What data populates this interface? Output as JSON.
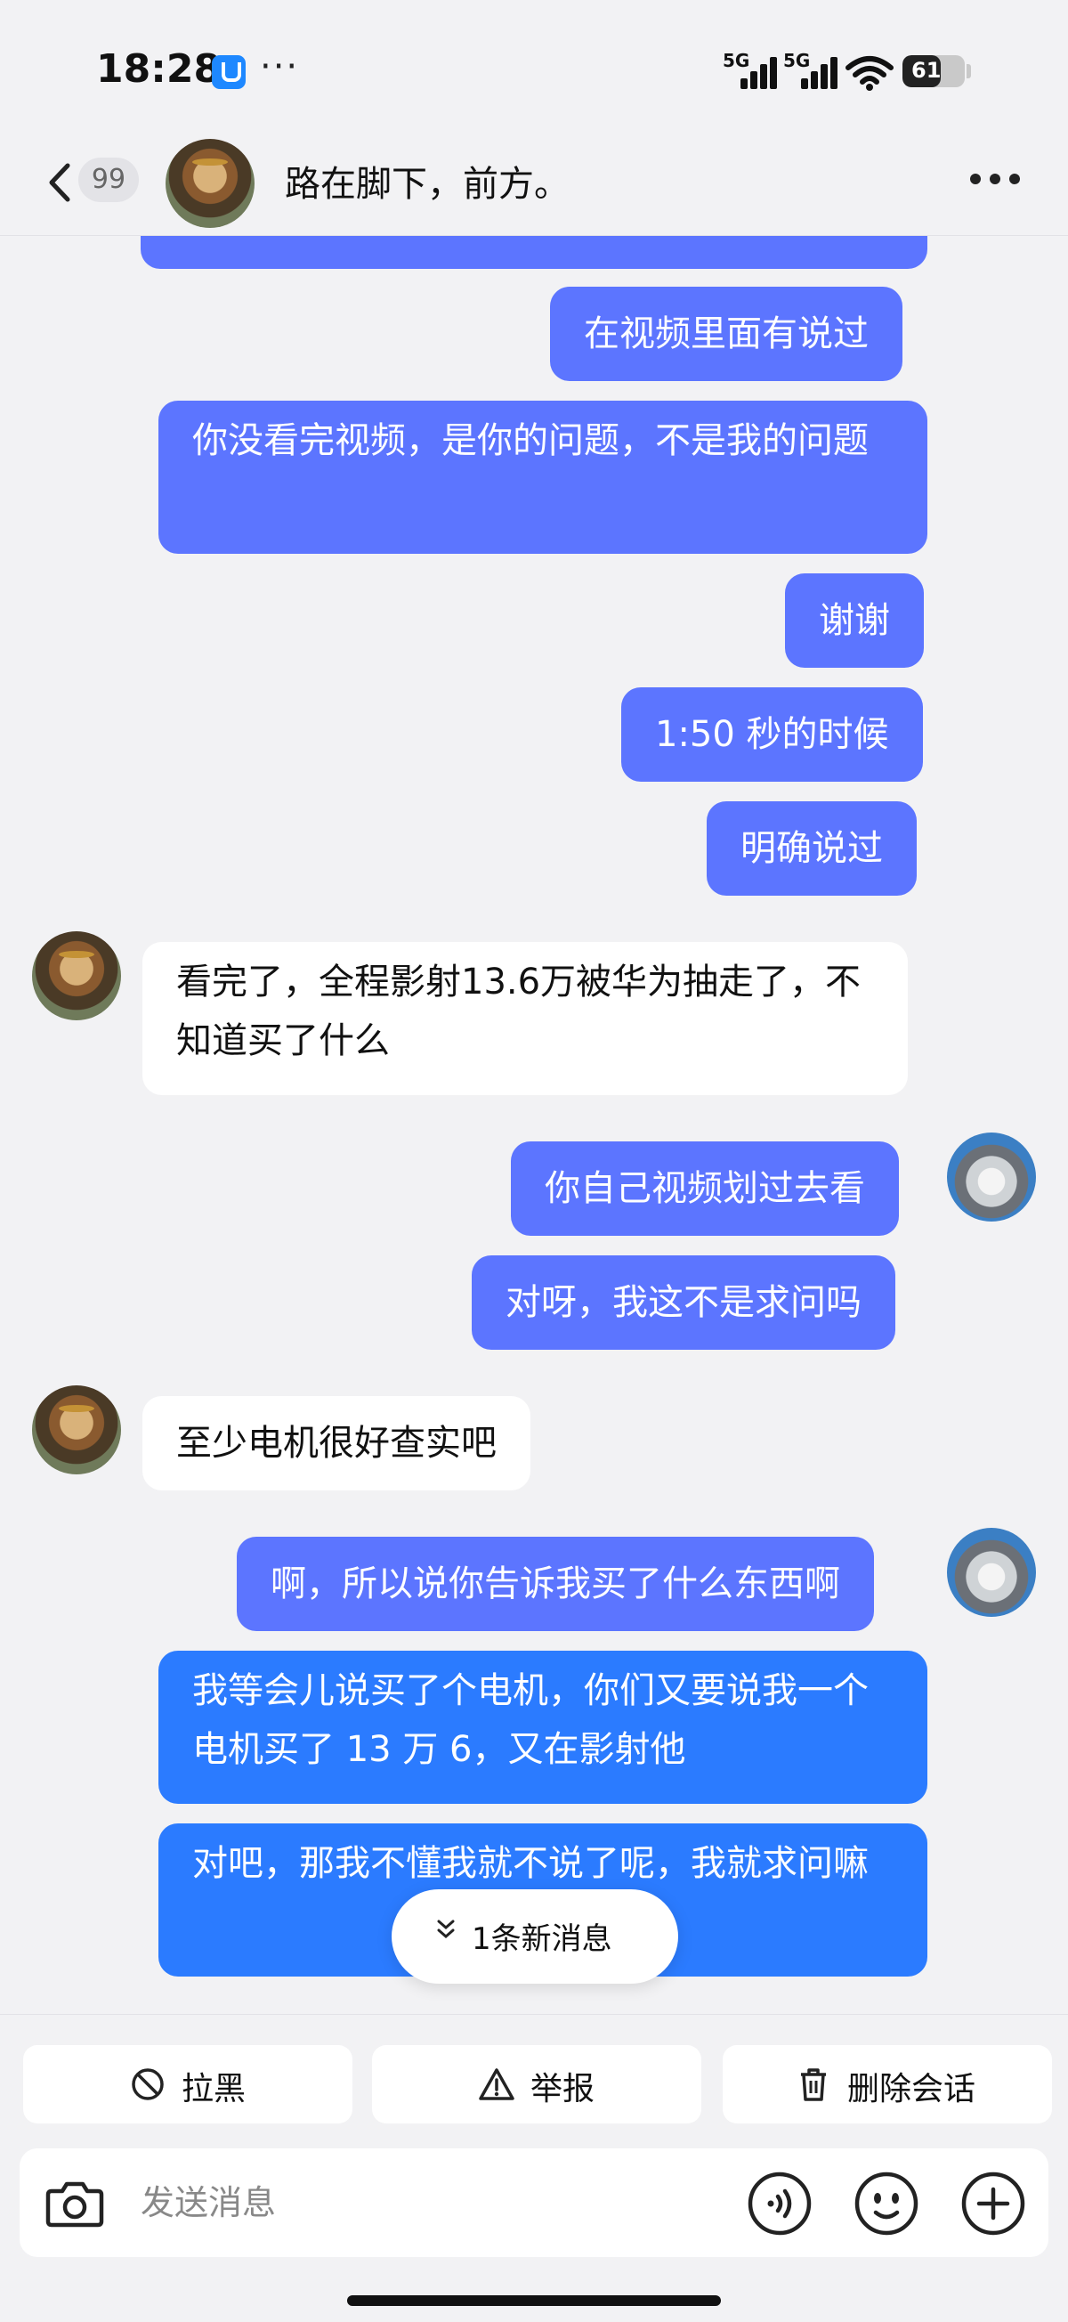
{
  "status_bar": {
    "time": "18:28",
    "app_icon": "shield-app-icon",
    "more": "···",
    "signal1_tag": "5G",
    "signal2_tag": "5G",
    "battery": "61",
    "battery_level_percent": 61
  },
  "header": {
    "unread_count": "99",
    "title": "路在脚下，前方。",
    "back_icon": "chevron-left-icon",
    "more_icon": "more-dots-icon"
  },
  "messages": [
    {
      "side": "out",
      "text": "在视频里面有说过"
    },
    {
      "side": "out",
      "text": "你没看完视频，是你的问题，不是我的问题"
    },
    {
      "side": "out",
      "text": "谢谢"
    },
    {
      "side": "out",
      "text": "1:50 秒的时候"
    },
    {
      "side": "out",
      "text": "明确说过"
    },
    {
      "side": "in",
      "text": "看完了，全程影射13.6万被华为抽走了，不知道买了什么"
    },
    {
      "side": "out",
      "text": "你自己视频划过去看"
    },
    {
      "side": "out",
      "text": "对呀，我这不是求问吗"
    },
    {
      "side": "in",
      "text": "至少电机很好查实吧"
    },
    {
      "side": "out",
      "text": "啊，所以说你告诉我买了什么东西啊"
    },
    {
      "side": "out",
      "text": "我等会儿说买了个电机，你们又要说我一个电机买了 13 万 6，又在影射他"
    },
    {
      "side": "out",
      "text": "对吧，那我不懂我就不说了呢，我就求问嘛"
    }
  ],
  "new_message_pill": {
    "label": "1条新消息",
    "icon": "double-chevron-down-icon"
  },
  "actions": {
    "block": {
      "label": "拉黑",
      "icon": "block-icon"
    },
    "report": {
      "label": "举报",
      "icon": "warning-icon"
    },
    "delete": {
      "label": "删除会话",
      "icon": "trash-icon"
    }
  },
  "input": {
    "placeholder": "发送消息",
    "camera_icon": "camera-icon",
    "voice_icon": "voice-icon",
    "emoji_icon": "emoji-icon",
    "plus_icon": "plus-icon"
  },
  "colors": {
    "outgoing_bubble": "#5c75ff",
    "outgoing_bubble_latest": "#2b7bff",
    "incoming_bubble": "#ffffff",
    "background": "#f2f2f4"
  }
}
